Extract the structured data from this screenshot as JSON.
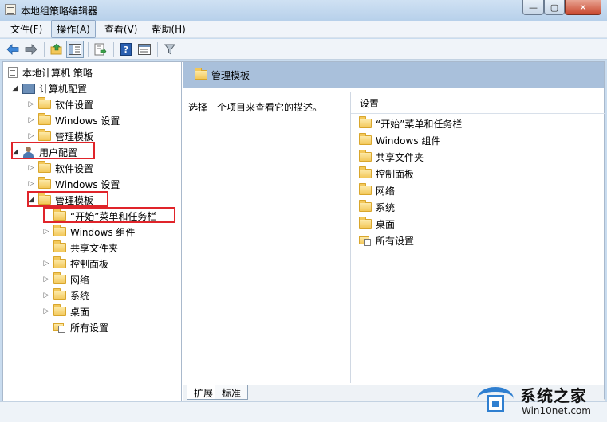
{
  "window": {
    "title": "本地组策略编辑器",
    "minimize_glyph": "—",
    "maximize_glyph": "▢",
    "close_glyph": "✕"
  },
  "menu": [
    "文件(F)",
    "操作(A)",
    "查看(V)",
    "帮助(H)"
  ],
  "active_menu_index": 1,
  "toolbar": {
    "icons": [
      "back-arrow-icon",
      "forward-arrow-icon",
      "up-folder-icon",
      "show-hide-tree-icon",
      "export-list-icon",
      "help-icon",
      "properties-icon",
      "filter-icon"
    ]
  },
  "tree": {
    "root": "本地计算机 策略",
    "computer_config": {
      "label": "计算机配置",
      "children": [
        "软件设置",
        "Windows 设置",
        "管理模板"
      ]
    },
    "user_config": {
      "label": "用户配置",
      "children": [
        "软件设置",
        "Windows 设置"
      ],
      "admin_templates": {
        "label": "管理模板",
        "children": [
          "“开始”菜单和任务栏",
          "Windows 组件",
          "共享文件夹",
          "控制面板",
          "网络",
          "系统",
          "桌面",
          "所有设置"
        ]
      }
    }
  },
  "right_pane": {
    "header_title": "管理模板",
    "description": "选择一个项目来查看它的描述。",
    "column_header": "设置",
    "items": [
      "“开始”菜单和任务栏",
      "Windows 组件",
      "共享文件夹",
      "控制面板",
      "网络",
      "系统",
      "桌面",
      "所有设置"
    ]
  },
  "tabs": [
    "扩展",
    "标准"
  ],
  "watermark": {
    "brand": "系统之家",
    "url": "Win10net.com"
  },
  "colors": {
    "highlight_box": "#e0242a",
    "header_band": "#a9c0db",
    "folder": "#f3c85a"
  }
}
